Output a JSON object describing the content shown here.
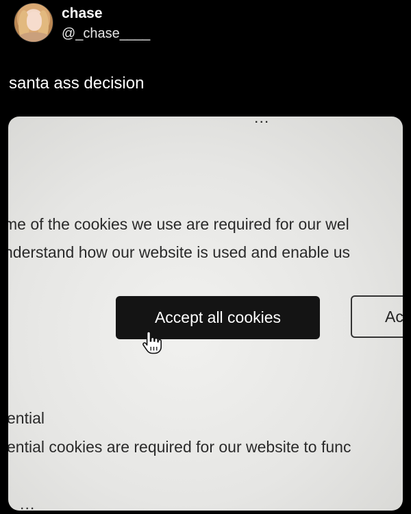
{
  "tweet": {
    "display_name": "chase",
    "handle": "@_chase____",
    "text": "santa ass decision"
  },
  "photo": {
    "top_cut_text": "...",
    "consent_line_1": "me of the cookies we use are required for our wel",
    "consent_line_2": "nderstand how our website is used and enable us",
    "accept_button_label": "Accept all cookies",
    "other_button_label": "Ac",
    "section_title": "ential",
    "section_desc": "ential cookies are required for our website to func",
    "bottom_cut_text": "..."
  },
  "icons": {
    "cursor": "hand-pointer-icon",
    "avatar": "user-avatar"
  },
  "colors": {
    "background": "#000000",
    "photo_bg": "#e6e6e4",
    "accept_button_bg": "#141414"
  }
}
